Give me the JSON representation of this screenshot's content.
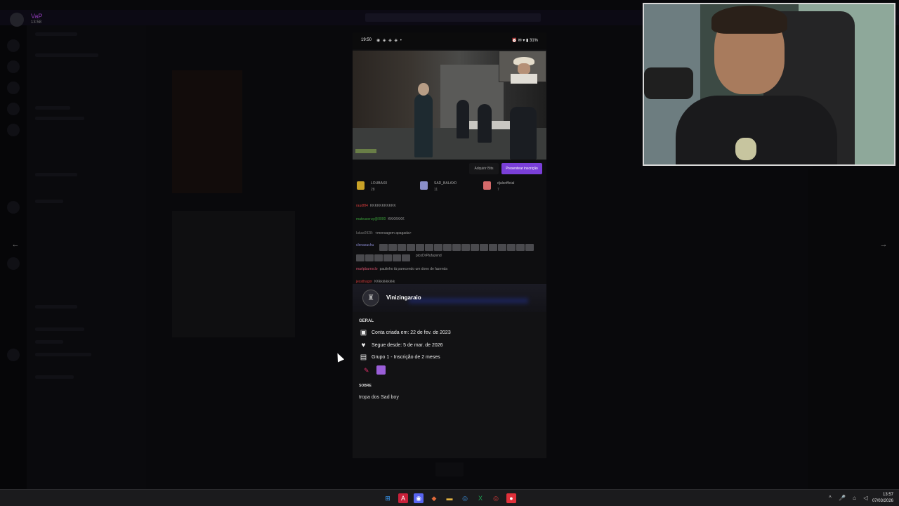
{
  "account": {
    "name": "VaP",
    "status": "13:58"
  },
  "phone": {
    "status_time": "19:50",
    "status_icons": "◉ ◈ ◈ ◈ •",
    "status_right": "⏰ ✉ ▾ ▮ 31%",
    "buttons": {
      "bits": "Adquirir Bits",
      "subscribe": "Presentear inscrição"
    },
    "leaders": [
      {
        "name": "LOUBAX0",
        "value": "28",
        "color": "#c9a227"
      },
      {
        "name": "SAD_BALAX0",
        "value": "11",
        "color": "#8a8fc9"
      },
      {
        "name": "djalsofficial",
        "value": "7",
        "color": "#d46a6a"
      }
    ],
    "chat": [
      {
        "user": "raudf84",
        "user_color": "#d13a3a",
        "text": "KKKKKKKKKKK"
      },
      {
        "user": "mateuseruy@0000",
        "user_color": "#3aa03a",
        "text": "KKKKKKK"
      },
      {
        "user": "lukas0928:",
        "user_color": "#777777",
        "text": "<mensagem apagada>"
      },
      {
        "user": "clenasuchu",
        "user_color": "#8a8ad0",
        "text": ""
      },
      {
        "user": "",
        "user_color": "#999999",
        "text": "picoDrPlufazend"
      },
      {
        "user": "marlpbarroclo",
        "user_color": "#d0506a",
        "text": "paulinho tá parecendo um dono de fazenda"
      },
      {
        "user": "jessthagor",
        "user_color": "#d13a3a",
        "text": "KKkkkkkkkkk"
      }
    ]
  },
  "profile": {
    "username": "Vinizingaraio",
    "section_general": "GERAL",
    "created": "Conta criada em: 22 de fev. de 2023",
    "following": "Segue desde: 5 de mar. de 2026",
    "subscription": "Grupo 1 - Inscrição de 2 meses",
    "section_about": "SOBRE",
    "about": "tropa dos Sad boy"
  },
  "taskbar": {
    "icons": [
      {
        "name": "windows-start-icon",
        "glyph": "⊞",
        "color": "#3aa0ff"
      },
      {
        "name": "app-a-icon",
        "glyph": "A",
        "color": "#c8203a"
      },
      {
        "name": "discord-icon",
        "glyph": "◉",
        "color": "#5865f2"
      },
      {
        "name": "app-color-icon",
        "glyph": "◆",
        "color": "#e26a3a"
      },
      {
        "name": "folder-icon",
        "glyph": "▬",
        "color": "#e3b341"
      },
      {
        "name": "chrome-icon",
        "glyph": "◎",
        "color": "#3a8ad4"
      },
      {
        "name": "excel-icon",
        "glyph": "X",
        "color": "#1d6f42"
      },
      {
        "name": "app-ring-icon",
        "glyph": "◎",
        "color": "#d23a3a"
      },
      {
        "name": "record-icon",
        "glyph": "●",
        "color": "#e0303a"
      }
    ],
    "tray": "^ 🎤 ⌂ ◁",
    "time": "13:57",
    "date": "07/03/2026"
  }
}
